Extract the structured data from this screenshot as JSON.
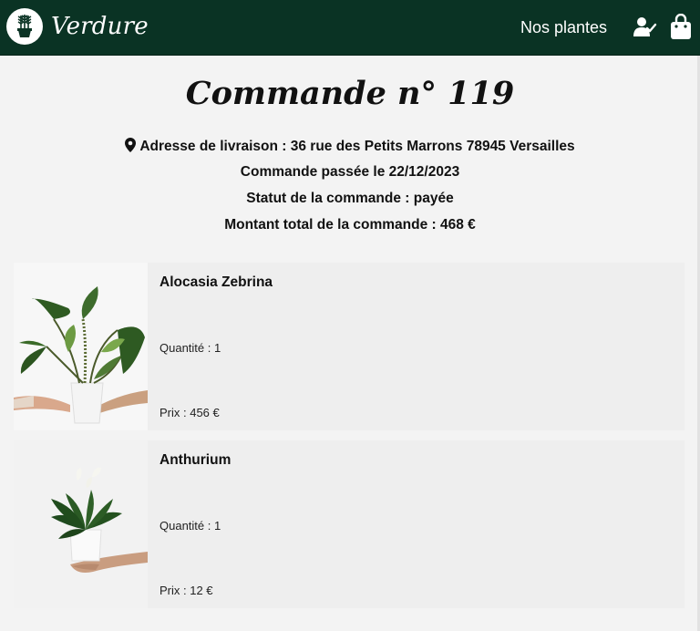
{
  "navbar": {
    "brand": "Verdure",
    "link": "Nos plantes",
    "icons": [
      "plant-logo-icon",
      "user-check-icon",
      "shopping-bag-icon"
    ],
    "color": "#0a3324"
  },
  "order": {
    "title": "Commande n° 119",
    "address_label": "Adresse de livraison : 36 rue des Petits Marrons 78945 Versailles",
    "date_label": "Commande passée le 22/12/2023",
    "status_label": "Statut de la commande : payée",
    "total_label": "Montant total de la commande : 468 €"
  },
  "items": [
    {
      "name": "Alocasia Zebrina",
      "quantity": "Quantité : 1",
      "price": "Prix : 456 €"
    },
    {
      "name": "Anthurium",
      "quantity": "Quantité : 1",
      "price": "Prix : 12 €"
    }
  ]
}
